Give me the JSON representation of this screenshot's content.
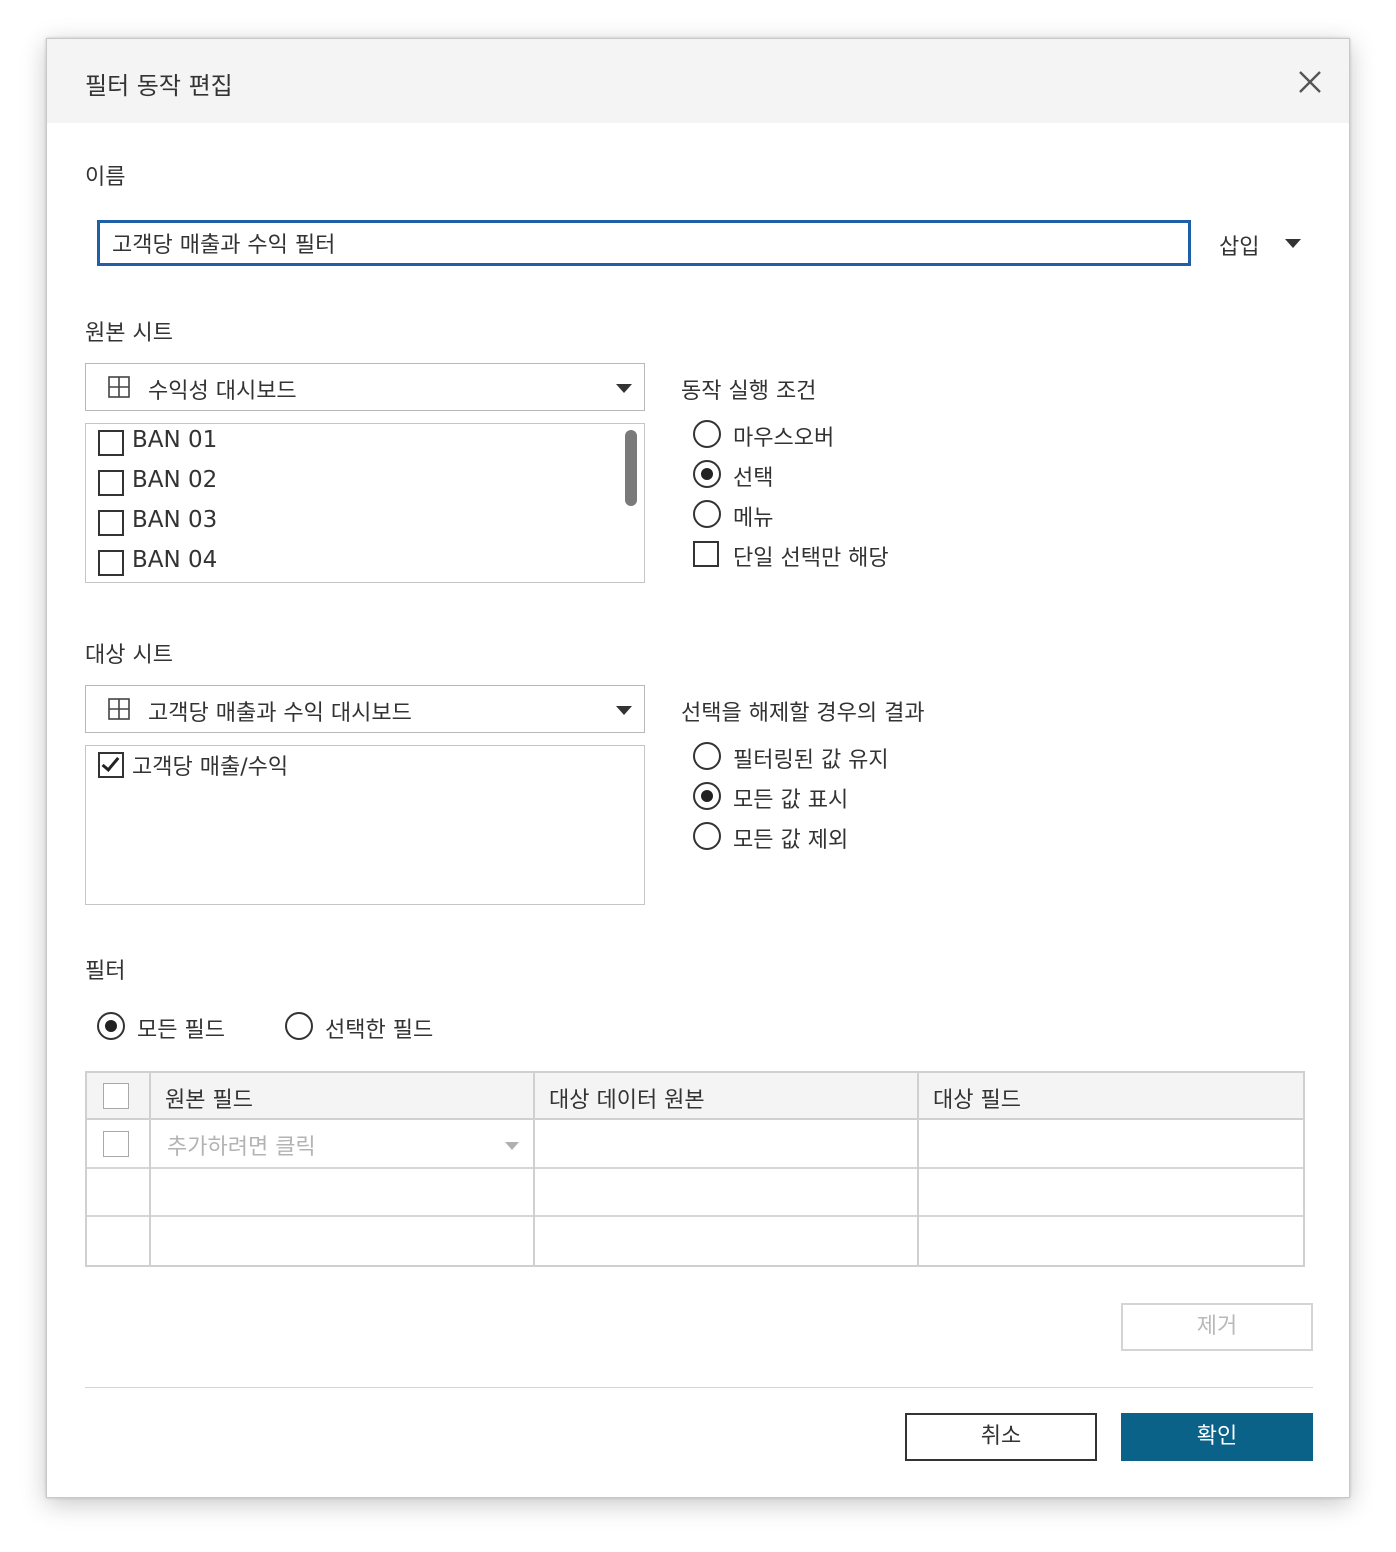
{
  "dialog": {
    "title": "필터 동작 편집",
    "close_icon": "close-icon"
  },
  "name": {
    "label": "이름",
    "value": "고객당 매출과 수익 필터",
    "insert_label": "삽입"
  },
  "source": {
    "label": "원본 시트",
    "selected": "수익성 대시보드",
    "sheets": [
      {
        "label": "BAN 01",
        "checked": false
      },
      {
        "label": "BAN 02",
        "checked": false
      },
      {
        "label": "BAN 03",
        "checked": false
      },
      {
        "label": "BAN 04",
        "checked": false
      }
    ]
  },
  "run_on": {
    "label": "동작 실행 조건",
    "options": [
      "마우스오버",
      "선택",
      "메뉴"
    ],
    "selected": "선택",
    "single_select_label": "단일 선택만 해당",
    "single_select_checked": false
  },
  "target": {
    "label": "대상 시트",
    "selected": "고객당 매출과 수익 대시보드",
    "sheets": [
      {
        "label": "고객당 매출/수익",
        "checked": true
      }
    ]
  },
  "clearing": {
    "label": "선택을 해제할 경우의 결과",
    "options": [
      "필터링된 값 유지",
      "모든 값 표시",
      "모든 값 제외"
    ],
    "selected": "모든 값 표시"
  },
  "filter": {
    "label": "필터",
    "options": [
      "모든 필드",
      "선택한 필드"
    ],
    "selected": "모든 필드",
    "table": {
      "columns": [
        "원본 필드",
        "대상 데이터 원본",
        "대상 필드"
      ],
      "add_placeholder": "추가하려면 클릭"
    },
    "remove_label": "제거"
  },
  "footer": {
    "cancel_label": "취소",
    "ok_label": "확인"
  },
  "colors": {
    "accent": "#0b6289",
    "input_focus": "#1f5fa6"
  }
}
